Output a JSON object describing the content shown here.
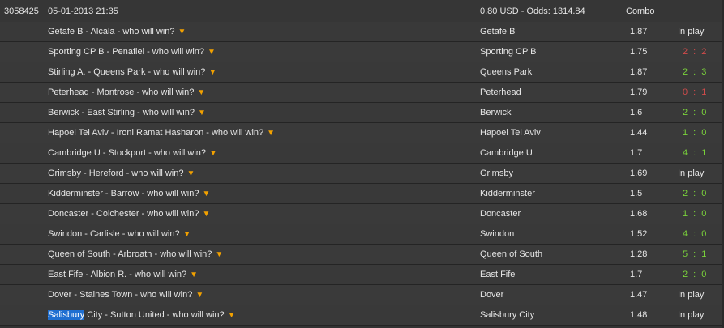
{
  "header": {
    "ticket_id": "3058425",
    "datetime": "05-01-2013 21:35",
    "stake_odds": "0.80 USD - Odds: 1314.84",
    "type": "Combo"
  },
  "colors": {
    "win": "#7ad33b",
    "lose": "#d24b4b",
    "arrow": "#f2a100",
    "highlight": "#1f6fd1"
  },
  "rows": [
    {
      "match": "Getafe B - Alcala - who will win?",
      "pick": "Getafe B",
      "odds": "1.87",
      "status": "In play",
      "kind": "inplay"
    },
    {
      "match": "Sporting CP B - Penafiel - who will win?",
      "pick": "Sporting CP B",
      "odds": "1.75",
      "status": "2 : 2",
      "kind": "lose"
    },
    {
      "match": "Stirling A. - Queens Park - who will win?",
      "pick": "Queens Park",
      "odds": "1.87",
      "status": "2 : 3",
      "kind": "win"
    },
    {
      "match": "Peterhead - Montrose - who will win?",
      "pick": "Peterhead",
      "odds": "1.79",
      "status": "0 : 1",
      "kind": "lose"
    },
    {
      "match": "Berwick - East Stirling - who will win?",
      "pick": "Berwick",
      "odds": "1.6",
      "status": "2 : 0",
      "kind": "win"
    },
    {
      "match": "Hapoel Tel Aviv - Ironi Ramat Hasharon - who will win?",
      "pick": "Hapoel Tel Aviv",
      "odds": "1.44",
      "status": "1 : 0",
      "kind": "win"
    },
    {
      "match": "Cambridge U - Stockport - who will win?",
      "pick": "Cambridge U",
      "odds": "1.7",
      "status": "4 : 1",
      "kind": "win"
    },
    {
      "match": "Grimsby - Hereford - who will win?",
      "pick": "Grimsby",
      "odds": "1.69",
      "status": "In play",
      "kind": "inplay"
    },
    {
      "match": "Kidderminster - Barrow - who will win?",
      "pick": "Kidderminster",
      "odds": "1.5",
      "status": "2 : 0",
      "kind": "win"
    },
    {
      "match": "Doncaster - Colchester - who will win?",
      "pick": "Doncaster",
      "odds": "1.68",
      "status": "1 : 0",
      "kind": "win"
    },
    {
      "match": "Swindon - Carlisle - who will win?",
      "pick": "Swindon",
      "odds": "1.52",
      "status": "4 : 0",
      "kind": "win"
    },
    {
      "match": "Queen of South - Arbroath - who will win?",
      "pick": "Queen of South",
      "odds": "1.28",
      "status": "5 : 1",
      "kind": "win"
    },
    {
      "match": "East Fife - Albion R. - who will win?",
      "pick": "East Fife",
      "odds": "1.7",
      "status": "2 : 0",
      "kind": "win"
    },
    {
      "match": "Dover - Staines Town - who will win?",
      "pick": "Dover",
      "odds": "1.47",
      "status": "In play",
      "kind": "inplay"
    },
    {
      "match": "Salisbury City - Sutton United - who will win?",
      "pick": "Salisbury City",
      "odds": "1.48",
      "status": "In play",
      "kind": "inplay",
      "highlight": "Salisbury"
    }
  ]
}
